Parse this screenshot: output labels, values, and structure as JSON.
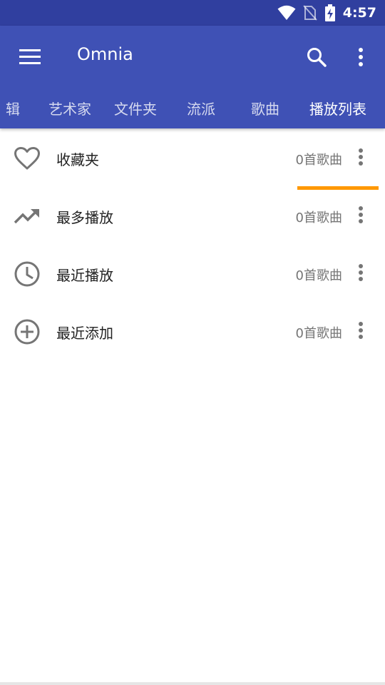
{
  "status_bar": {
    "time": "4:57",
    "icons": [
      "wifi-icon",
      "no-sim-icon",
      "battery-charging-icon"
    ]
  },
  "app_bar": {
    "title": "Omnia",
    "menu_icon": "menu-icon",
    "search_icon": "search-icon",
    "overflow_icon": "more-vert-icon"
  },
  "tabs": [
    {
      "label": "辑",
      "active": false
    },
    {
      "label": "艺术家",
      "active": false
    },
    {
      "label": "文件夹",
      "active": false
    },
    {
      "label": "流派",
      "active": false
    },
    {
      "label": "歌曲",
      "active": false
    },
    {
      "label": "播放列表",
      "active": true
    }
  ],
  "colors": {
    "status_bar": "#303f9f",
    "app_bar": "#3f51b5",
    "tab_indicator": "#ff9800",
    "icon_gray": "#757575"
  },
  "playlists": [
    {
      "icon": "heart-icon",
      "name": "收藏夹",
      "count": "0首歌曲"
    },
    {
      "icon": "trending-up-icon",
      "name": "最多播放",
      "count": "0首歌曲"
    },
    {
      "icon": "clock-icon",
      "name": "最近播放",
      "count": "0首歌曲"
    },
    {
      "icon": "add-circle-icon",
      "name": "最近添加",
      "count": "0首歌曲"
    }
  ]
}
